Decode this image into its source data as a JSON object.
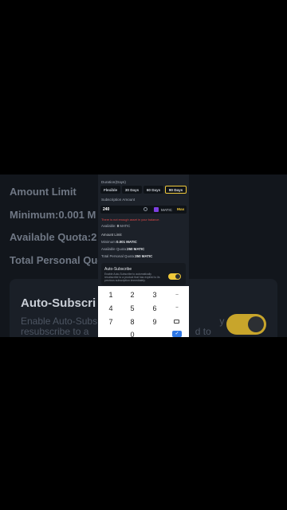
{
  "background": {
    "amount_limit": "Amount Limit",
    "minimum": "Minimum:0.001 M",
    "available_quota": "Available Quota:2",
    "total_personal": "Total Personal Quo",
    "auto_title": "Auto-Subscri",
    "auto_desc_1": "Enable Auto-Subs",
    "auto_desc_1b": "y",
    "auto_desc_2": "resubscribe to a",
    "auto_desc_2b": "d to"
  },
  "panel": {
    "duration_label": "Duration(Days)",
    "tabs": [
      "Flexible",
      "30 Days",
      "60 Days",
      "90 Days"
    ],
    "subscription_label": "Subscription Amount",
    "amount_value": "240",
    "coin": "MATIC",
    "max": "Max",
    "error": "There is not enough asset in your balance.",
    "available_label": "Available:",
    "available_value": "0",
    "available_unit": "MATIC",
    "amount_limit": "Amount Limit",
    "minimum_label": "Minimum:",
    "minimum_value": "0.001 MATIC",
    "available_quota_label": "Available Quota:",
    "available_quota_value": "250 MATIC",
    "total_label": "Total Personal Quota:",
    "total_value": "250 MATIC",
    "auto_title": "Auto-Subscribe",
    "auto_desc": "Enable Auto-Subscribe to automatically resubscribe to a product that has expired to its previous subscription immediately.",
    "auto_enabled": true
  },
  "keypad": {
    "keys": [
      "1",
      "2",
      "3",
      "–",
      "4",
      "5",
      "6",
      "⌣",
      "7",
      "8",
      "9",
      "⌫",
      "",
      "0",
      "",
      "✓"
    ]
  },
  "colors": {
    "accent": "#f0c93a",
    "error": "#e04848",
    "panel_bg": "#1c2129"
  }
}
